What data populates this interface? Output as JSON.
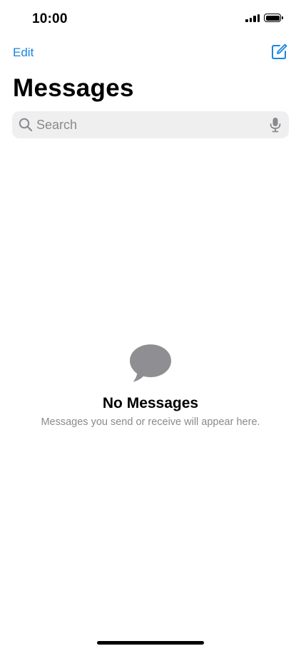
{
  "status_bar": {
    "time": "10:00",
    "signal_icon": "cellular-signal-icon",
    "battery_icon": "battery-icon",
    "battery_level": 1.0
  },
  "nav": {
    "edit_label": "Edit",
    "compose_icon": "compose-icon"
  },
  "page": {
    "title": "Messages"
  },
  "search": {
    "placeholder": "Search",
    "value": "",
    "search_icon": "magnifying-glass-icon",
    "mic_icon": "microphone-icon"
  },
  "empty_state": {
    "icon": "speech-bubble-icon",
    "title": "No Messages",
    "subtitle": "Messages you send or receive will appear here."
  },
  "colors": {
    "accent": "#1a84e0",
    "secondary_text": "#8a8a8e",
    "search_background": "#efeff0",
    "bubble_icon": "#8e8e93"
  }
}
